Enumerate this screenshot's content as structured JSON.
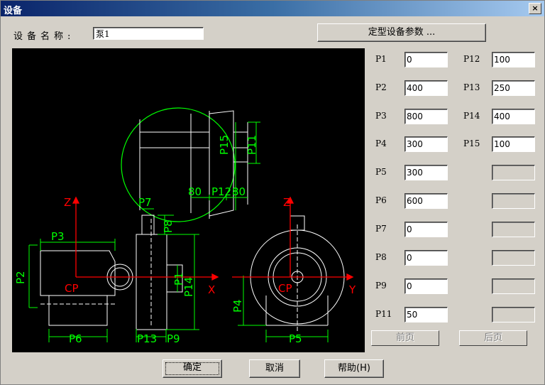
{
  "window": {
    "title": "设备",
    "close_label": "×"
  },
  "form": {
    "name_label": "设备名称:",
    "name_value": "泵1",
    "define_button": "定型设备参数 ..."
  },
  "drawing": {
    "labels": {
      "z": "Z",
      "x": "X",
      "y": "Y",
      "cp": "CP",
      "p1": "P1",
      "p2": "P2",
      "p3": "P3",
      "p4": "P4",
      "p5": "P5",
      "p6": "P6",
      "p7": "P7",
      "p8": "P8",
      "p9": "P9",
      "p11": "P11",
      "p12": "P12",
      "p13": "P13",
      "p14": "P14",
      "p15": "P15",
      "d80a": "80",
      "d80b": "80"
    }
  },
  "params": {
    "left": [
      {
        "label": "P1",
        "value": "0"
      },
      {
        "label": "P2",
        "value": "400"
      },
      {
        "label": "P3",
        "value": "800"
      },
      {
        "label": "P4",
        "value": "300"
      },
      {
        "label": "P5",
        "value": "300"
      },
      {
        "label": "P6",
        "value": "600"
      },
      {
        "label": "P7",
        "value": "0"
      },
      {
        "label": "P8",
        "value": "0"
      },
      {
        "label": "P9",
        "value": "0"
      },
      {
        "label": "P11",
        "value": "50"
      }
    ],
    "right": [
      {
        "label": "P12",
        "value": "100"
      },
      {
        "label": "P13",
        "value": "250"
      },
      {
        "label": "P14",
        "value": "400"
      },
      {
        "label": "P15",
        "value": "100"
      }
    ],
    "prev_page": "前页",
    "next_page": "后页"
  },
  "buttons": {
    "ok": "确定",
    "cancel": "取消",
    "help": "帮助(H)"
  },
  "colors": {
    "drawing_bg": "#000000",
    "drawing_white": "#ffffff",
    "dimension_green": "#00ff00",
    "axis_red": "#ff0000"
  }
}
